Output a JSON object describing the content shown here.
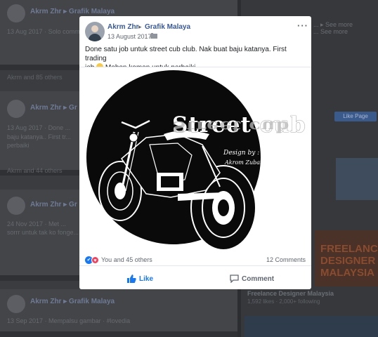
{
  "background_feed": {
    "posts": [
      {
        "author": "Akrm Zhr",
        "arrow": "▸",
        "group": "Grafik Malaya",
        "meta": "13 Aug 2017 · ",
        "snippet": "Solo comm..."
      },
      {
        "author": "Akrm Zhr",
        "arrow": "▸",
        "group": "Gr",
        "meta": "13 Aug 2017 · ",
        "snippet": "Done ...",
        "line2": "baju katanya.. First tr...",
        "line3": "perbaiki"
      },
      {
        "author": "Akrm Zhr",
        "arrow": "▸",
        "group": "Gr",
        "meta": "24 Nov 2017 · ",
        "snippet": "Met ...",
        "line2": "sorrr untuk tak ko fonge..."
      },
      {
        "author": "Akrm Zhr",
        "arrow": "▸",
        "group": "Grafik Malaya",
        "meta": "13 Sep 2017 · ",
        "snippet": "Mempalsu gambar · #lovedia"
      }
    ],
    "reaction_rows": [
      "Akrm and 85 others",
      "Akrm and 44 others"
    ],
    "right_column": {
      "line1": "... ▸ See more",
      "line2": "... See more",
      "like_page_label": "Like Page",
      "ad_text": "FREELANCE DESIGNER MALAYSIA",
      "ad_title": "Freelance Designer Malaysia",
      "ad_sub": "1,592 likes · 2,000+ following"
    }
  },
  "modal": {
    "author": "Akrm Zhr",
    "arrow": "▸",
    "group": "Grafik Malaya",
    "date": "13 August 2017 ·",
    "more_icon_label": "···",
    "post_text_line1": "Done satu job untuk street cub club.  Nak buat baju katanya.  First trading",
    "post_text_line2_pre": "job",
    "post_text_line2_post": " Mohon komen untuk perbaiki",
    "image": {
      "title": "Street cub",
      "reflection": "Street cub",
      "design_by": "Design by :",
      "designer": "Akrom Zubair"
    },
    "reactions_text": "You and 45 others",
    "comments_text": "12 Comments",
    "like_label": "Like",
    "comment_label": "Comment",
    "colors": {
      "link": "#385898",
      "like_blue": "#1877f2",
      "love_red": "#f3425f",
      "muted": "#606770"
    }
  }
}
